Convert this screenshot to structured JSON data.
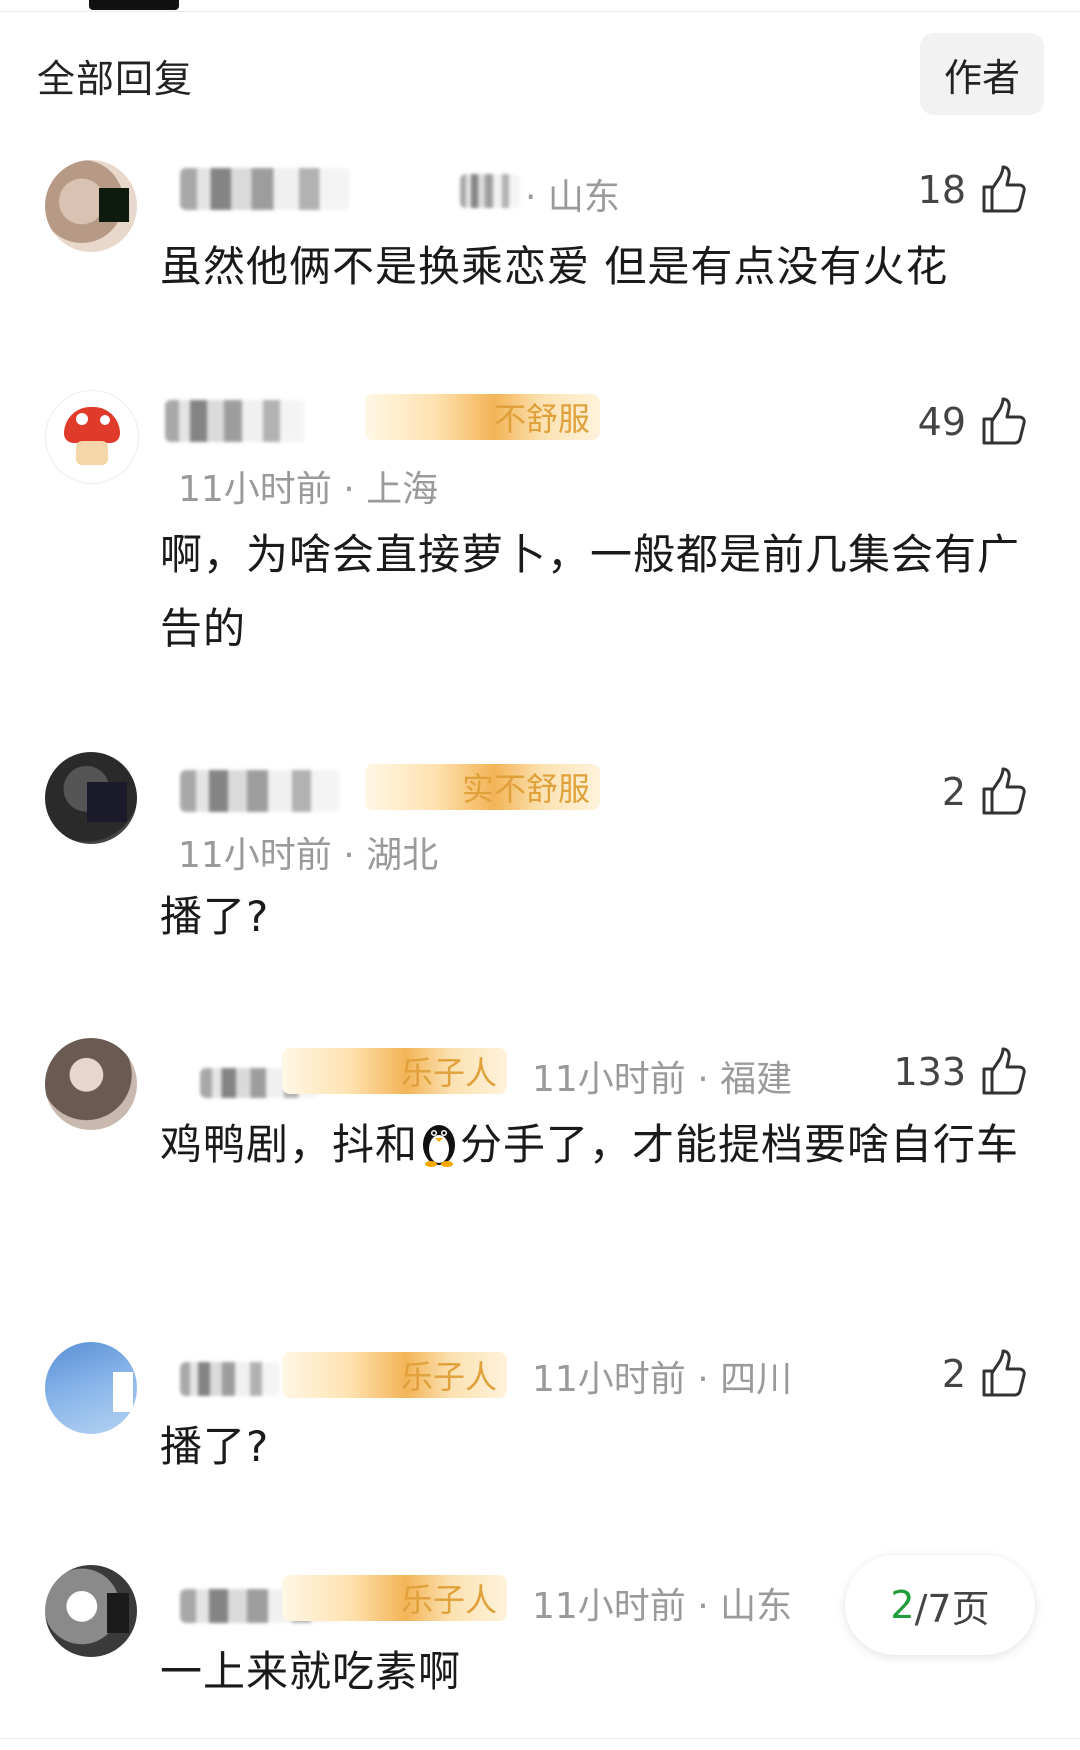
{
  "header": {
    "title": "全部回复",
    "author_button": "作者"
  },
  "comments": [
    {
      "location": "· 山东",
      "likes": "18",
      "text": "虽然他俩不是换乘恋爱 但是有点没有火花"
    },
    {
      "badge": "不舒服",
      "meta": "11小时前 · 上海",
      "likes": "49",
      "text": "啊，为啥会直接萝卜，一般都是前几集会有广告的"
    },
    {
      "badge": "实不舒服",
      "meta": "11小时前 · 湖北",
      "likes": "2",
      "text": "播了?"
    },
    {
      "badge": "乐子人",
      "meta": "11小时前 · 福建",
      "likes": "133",
      "text_before": "鸡鸭剧，抖和",
      "text_after": "分手了，才能提档要啥自行车"
    },
    {
      "badge": "乐子人",
      "meta": "11小时前 · 四川",
      "likes": "2",
      "text": "播了?"
    },
    {
      "badge": "乐子人",
      "meta": "11小时前 · 山东",
      "text": "一上来就吃素啊"
    }
  ],
  "pager": {
    "current": "2",
    "total": "/7页"
  },
  "icons": {
    "like": "thumbs-up-icon",
    "emoji": "penguin-icon"
  },
  "colors": {
    "badge_text": "#e0a03a",
    "pager_current": "#1f9d3a"
  }
}
